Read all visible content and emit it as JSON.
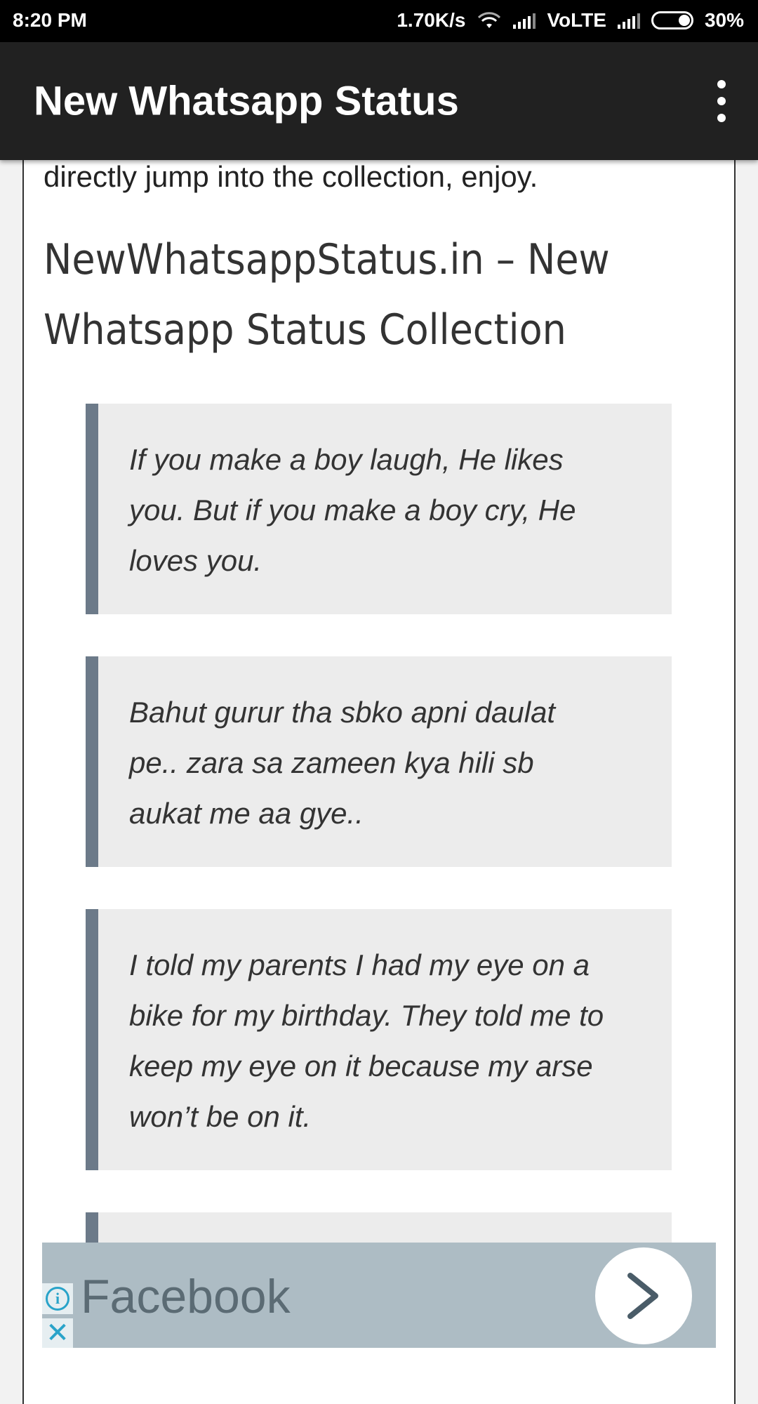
{
  "status_bar": {
    "time": "8:20 PM",
    "network_speed": "1.70K/s",
    "network_type": "VoLTE",
    "battery": "30%"
  },
  "app_bar": {
    "title": "New Whatsapp Status",
    "menu_icon": "more-vert-icon"
  },
  "article": {
    "intro_text": "directly jump into the collection, enjoy.",
    "heading_line1": "NewWhatsappStatus.in – New",
    "heading_line2": "Whatsapp Status Collection",
    "quotes": [
      {
        "line1": "If you make a boy laugh, He likes",
        "line2": "you. But if you make a boy cry, He",
        "line3": "loves you."
      },
      {
        "line1": "Bahut gurur tha sbko apni daulat",
        "line2": "pe.. zara sa zameen kya hili sb",
        "line3": "aukat me aa gye.."
      },
      {
        "line1": "I told my parents I had my eye on a",
        "line2": "bike for my birthday. They told me to",
        "line3": "keep my eye on it because my arse",
        "line4": "won’t be on it."
      }
    ]
  },
  "ad_banner": {
    "title": "Facebook",
    "info_icon": "info-icon",
    "close_icon": "close-icon",
    "arrow_icon": "chevron-right-icon",
    "background_color": "#adbcc4",
    "accent_color": "#29a3c9"
  },
  "colors": {
    "app_bar": "#212121",
    "quote_border": "#6c7a89",
    "quote_background": "#ececec"
  }
}
